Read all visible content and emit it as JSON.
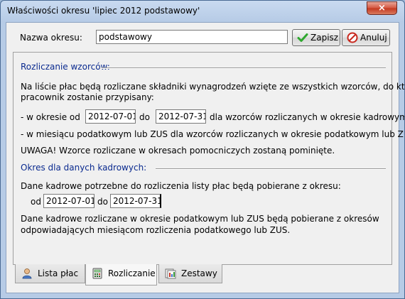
{
  "window": {
    "title": "Właściwości okresu 'lipiec 2012 podstawowy'",
    "close_glyph": "×"
  },
  "header": {
    "name_label": "Nazwa okresu:",
    "name_value": "podstawowy",
    "save_label": "Zapisz",
    "cancel_label": "Anuluj"
  },
  "settlement": {
    "section_title": "Rozliczanie wzorców:",
    "intro_line1": "Na liście płac będą rozliczane składniki wynagrodzeń wzięte ze wszystkich wzorców, do których",
    "intro_line2": "pracownik zostanie przypisany:",
    "period_prefix": "- w okresie od",
    "period_from": "2012-07-01",
    "period_to_label": "do",
    "period_to": "2012-07-31",
    "period_suffix": "dla wzorców rozliczanych w okresie kadrowym",
    "tax_month_line": "- w miesiącu podatkowym lub ZUS dla wzorców rozliczanych w okresie podatkowym lub ZUS.",
    "warning": "UWAGA! Wzorce rozliczane w okresach pomocniczych zostaną pominięte."
  },
  "hr_period": {
    "section_title": "Okres dla danych kadrowych:",
    "intro": "Dane kadrowe potrzebne do rozliczenia listy płac będą pobierane z okresu:",
    "from_label": "od",
    "from_value": "2012-07-01",
    "to_label": "do",
    "to_value": "2012-07-31",
    "note_line1": "Dane kadrowe rozliczane w okresie podatkowym lub ZUS będą pobierane z okresów",
    "note_line2": "odpowiadających miesiącom rozliczenia podatkowego lub ZUS."
  },
  "tabs": [
    {
      "label": "Lista płac",
      "icon": "user-icon",
      "active": false
    },
    {
      "label": "Rozliczanie",
      "icon": "calculator-icon",
      "active": true
    },
    {
      "label": "Zestawy",
      "icon": "sets-icon",
      "active": false
    }
  ],
  "colors": {
    "section_title": "#0a2a8f",
    "save_check": "#2fa82f",
    "cancel_icon": "#c8281e",
    "title_bar": "#b6cbe6"
  }
}
